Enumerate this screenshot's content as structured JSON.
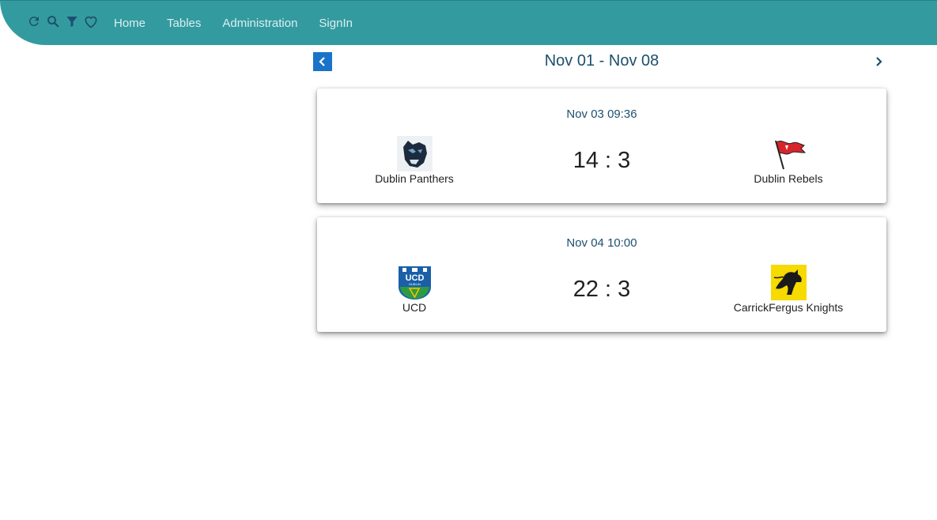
{
  "toolbar": {
    "icons": [
      "refresh-icon",
      "search-icon",
      "filter-icon",
      "heart-icon"
    ]
  },
  "nav": {
    "items": [
      "Home",
      "Tables",
      "Administration",
      "SignIn"
    ]
  },
  "week": {
    "title": "Nov 01 - Nov 08"
  },
  "matches": [
    {
      "time": "Nov 03 09:36",
      "score": "14 : 3",
      "home": {
        "name": "Dublin Panthers",
        "logo": "panther-logo-icon"
      },
      "away": {
        "name": "Dublin Rebels",
        "logo": "red-flag-logo-icon"
      }
    },
    {
      "time": "Nov 04 10:00",
      "score": "22 : 3",
      "home": {
        "name": "UCD",
        "logo": "ucd-crest-logo-icon"
      },
      "away": {
        "name": "CarrickFergus Knights",
        "logo": "knight-horse-logo-icon"
      }
    }
  ],
  "colors": {
    "topbar": "#339b9f",
    "accent": "#1a73c8",
    "title": "#1d4f6e"
  }
}
